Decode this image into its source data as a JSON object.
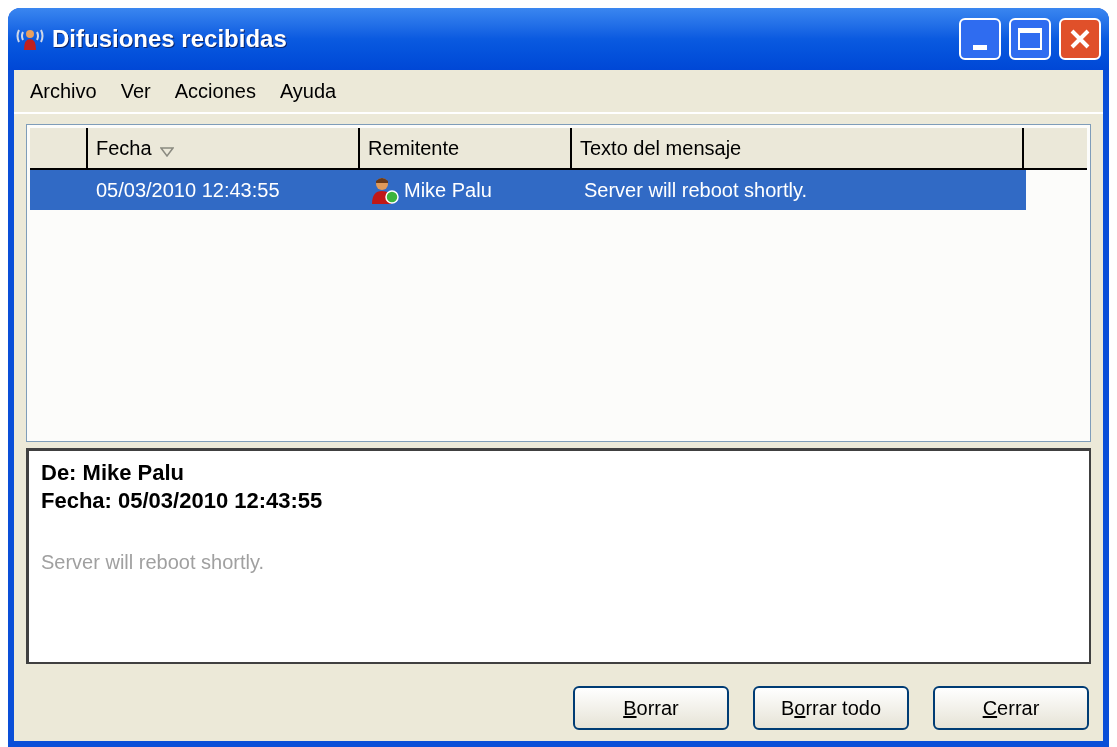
{
  "window": {
    "title": "Difusiones recibidas"
  },
  "menu": [
    "Archivo",
    "Ver",
    "Acciones",
    "Ayuda"
  ],
  "table": {
    "columns": [
      {
        "label": "Fecha",
        "sorted": true
      },
      {
        "label": "Remitente",
        "sorted": false
      },
      {
        "label": "Texto del mensaje",
        "sorted": false
      }
    ],
    "rows": [
      {
        "selected": true,
        "date": "05/03/2010 12:43:55",
        "sender": "Mike Palu",
        "message": "Server will reboot shortly."
      }
    ]
  },
  "preview": {
    "from": "De: Mike Palu",
    "date": "Fecha: 05/03/2010 12:43:55",
    "body": "Server will reboot shortly."
  },
  "buttons": [
    {
      "key": "B",
      "rest": "orrar"
    },
    {
      "pre": "B",
      "key": "o",
      "rest": "rrar todo"
    },
    {
      "key": "C",
      "rest": "errar"
    }
  ]
}
